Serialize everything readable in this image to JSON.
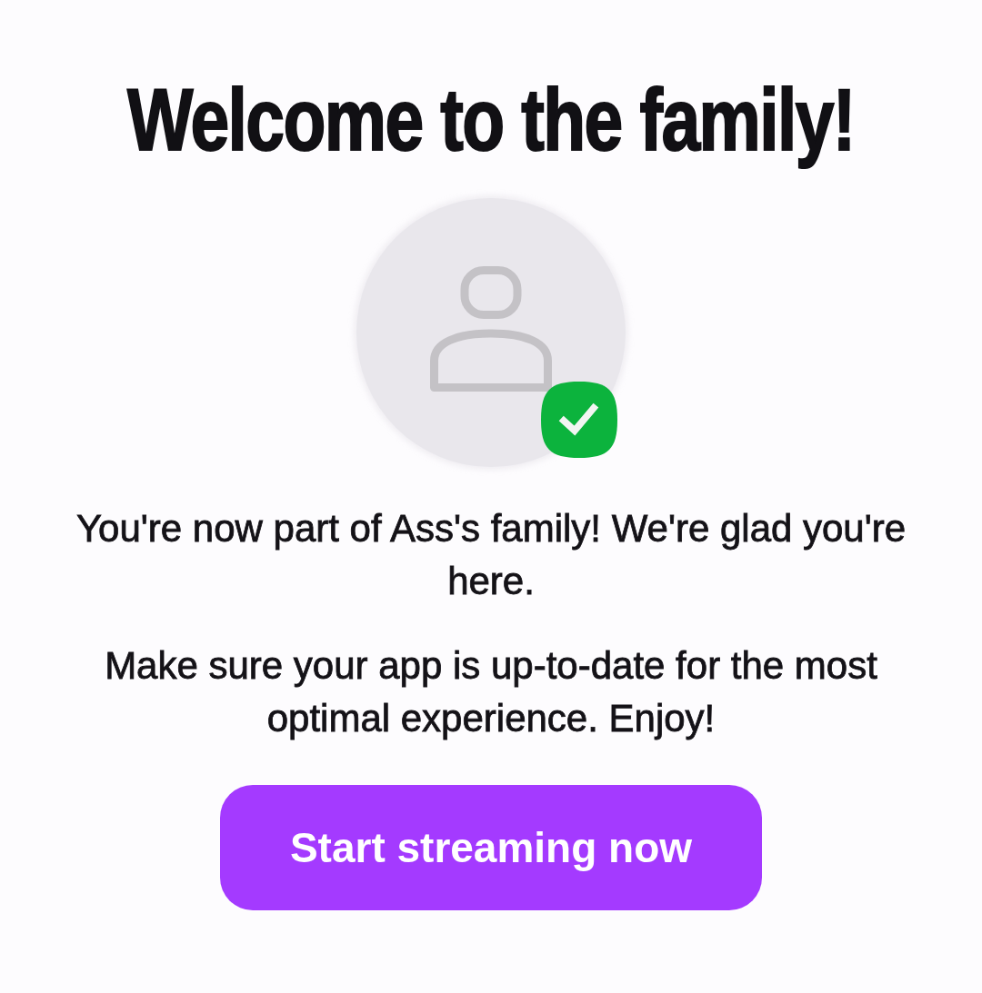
{
  "title": "Welcome to the family!",
  "avatar": {
    "verified": true
  },
  "paragraphs": [
    "You're now part of Ass's family! We're glad you're here.",
    "Make sure your app is up-to-date for the most optimal experience. Enjoy!"
  ],
  "button": {
    "label": "Start streaming now"
  }
}
